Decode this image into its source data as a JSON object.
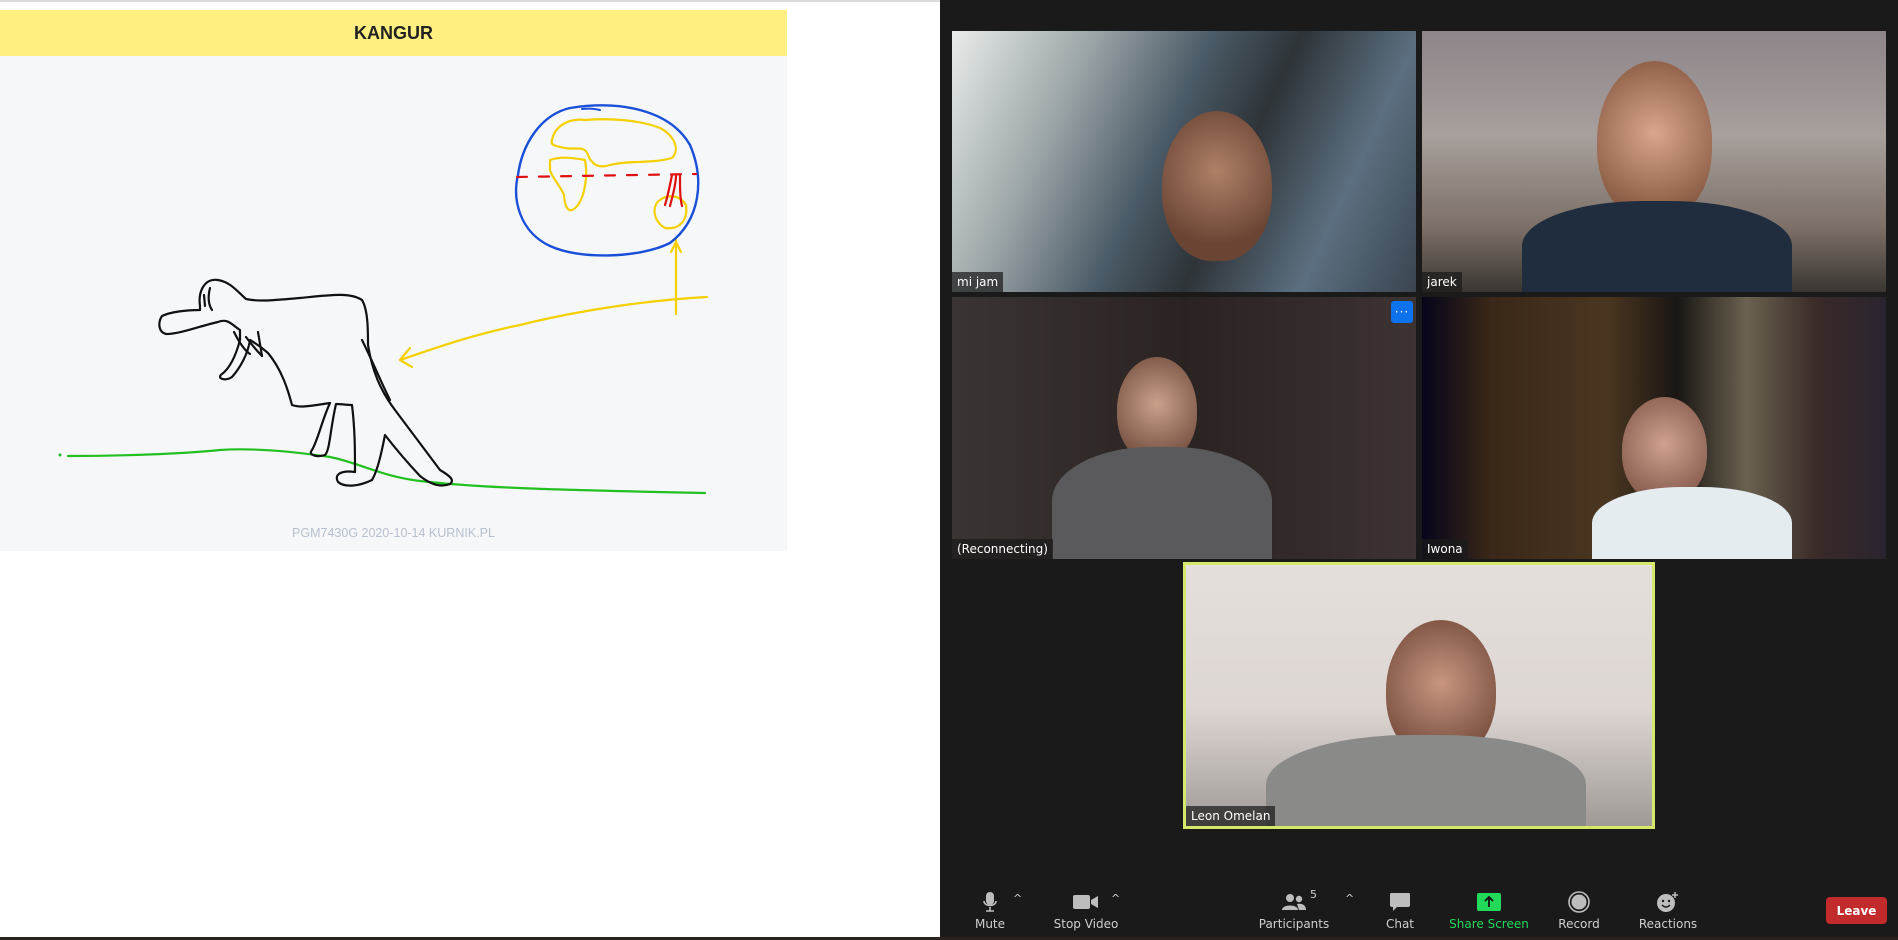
{
  "slide": {
    "title": "KANGUR",
    "footer": "PGM7430G 2020-10-14  KURNIK.PL",
    "colors": {
      "title_bg": "#ffee80",
      "panel_bg": "#f6f7f9",
      "footer_text": "#b6c0ce"
    },
    "strokes": [
      {
        "name": "kangaroo-outline",
        "color": "#111111"
      },
      {
        "name": "ground-line",
        "color": "#22c020"
      },
      {
        "name": "globe-outline",
        "color": "#1a4fd8"
      },
      {
        "name": "continents",
        "color": "#f5d000"
      },
      {
        "name": "equator-line",
        "color": "#e01010"
      },
      {
        "name": "pointer-arrow",
        "color": "#f5d000"
      }
    ]
  },
  "meeting": {
    "participants": [
      {
        "name": "mi jam",
        "tile": "top-left"
      },
      {
        "name": "jarek",
        "tile": "top-right"
      },
      {
        "name": "(Reconnecting)",
        "tile": "middle-left",
        "has_more_button": true
      },
      {
        "name": "Iwona",
        "tile": "middle-right"
      },
      {
        "name": "Leon Omelan",
        "tile": "bottom-center",
        "active_speaker": true
      }
    ],
    "more_button_label": "···",
    "active_speaker_color": "#d6e86a"
  },
  "toolbar": {
    "mute": {
      "label": "Mute",
      "icon": "microphone-icon"
    },
    "stop_video": {
      "label": "Stop Video",
      "icon": "video-camera-icon"
    },
    "participants": {
      "label": "Participants",
      "icon": "people-icon",
      "count": "5"
    },
    "chat": {
      "label": "Chat",
      "icon": "chat-bubble-icon"
    },
    "share_screen": {
      "label": "Share Screen",
      "icon": "share-arrow-icon",
      "color": "#23d959"
    },
    "record": {
      "label": "Record",
      "icon": "record-circle-icon"
    },
    "reactions": {
      "label": "Reactions",
      "icon": "smiley-plus-icon"
    },
    "leave": {
      "label": "Leave",
      "color": "#c12b2b"
    },
    "caret": "^"
  }
}
